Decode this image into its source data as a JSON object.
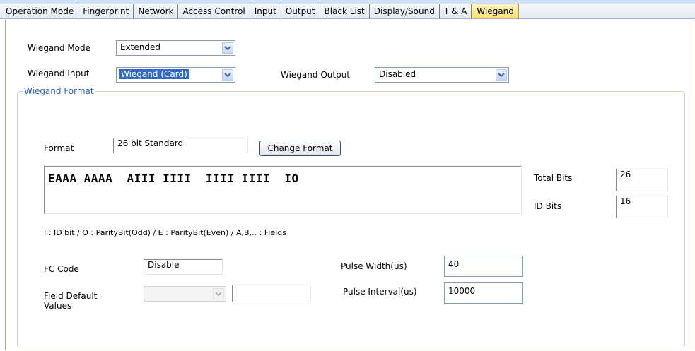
{
  "tabs": [
    {
      "label": "Operation Mode",
      "active": false
    },
    {
      "label": "Fingerprint",
      "active": false
    },
    {
      "label": "Network",
      "active": false
    },
    {
      "label": "Access Control",
      "active": false
    },
    {
      "label": "Input",
      "active": false
    },
    {
      "label": "Output",
      "active": false
    },
    {
      "label": "Black List",
      "active": false
    },
    {
      "label": "Display/Sound",
      "active": false
    },
    {
      "label": "T & A",
      "active": false
    },
    {
      "label": "Wiegand",
      "active": true
    }
  ],
  "wiegand_mode": {
    "label": "Wiegand Mode",
    "value": "Extended"
  },
  "wiegand_input": {
    "label": "Wiegand Input",
    "value": "Wiegand (Card)"
  },
  "wiegand_output": {
    "label": "Wiegand Output",
    "value": "Disabled"
  },
  "format_group": {
    "title": "Wiegand Format",
    "format_label": "Format",
    "format_value": "26 bit Standard",
    "change_button": "Change Format",
    "bit_pattern": "EAAA AAAA  AIII IIII  IIII IIII  IO",
    "total_bits_label": "Total Bits",
    "total_bits_value": "26",
    "id_bits_label": "ID Bits",
    "id_bits_value": "16",
    "legend_text": "I : ID bit  /  O : ParityBit(Odd)  /  E : ParityBit(Even)  /  A,B,.. : Fields",
    "fc_code_label": "FC Code",
    "fc_code_value": "Disable",
    "field_default_label": "Field Default Values",
    "field_default_select_value": "",
    "field_default_input_value": "",
    "pulse_width_label": "Pulse Width(us)",
    "pulse_width_value": "40",
    "pulse_interval_label": "Pulse Interval(us)",
    "pulse_interval_value": "10000"
  },
  "colors": {
    "active_tab": "#ffe06a",
    "group_title": "#2b5fb4",
    "selection_highlight": "#316ac5"
  },
  "icons": {
    "dropdown": "chevron-down-icon"
  }
}
